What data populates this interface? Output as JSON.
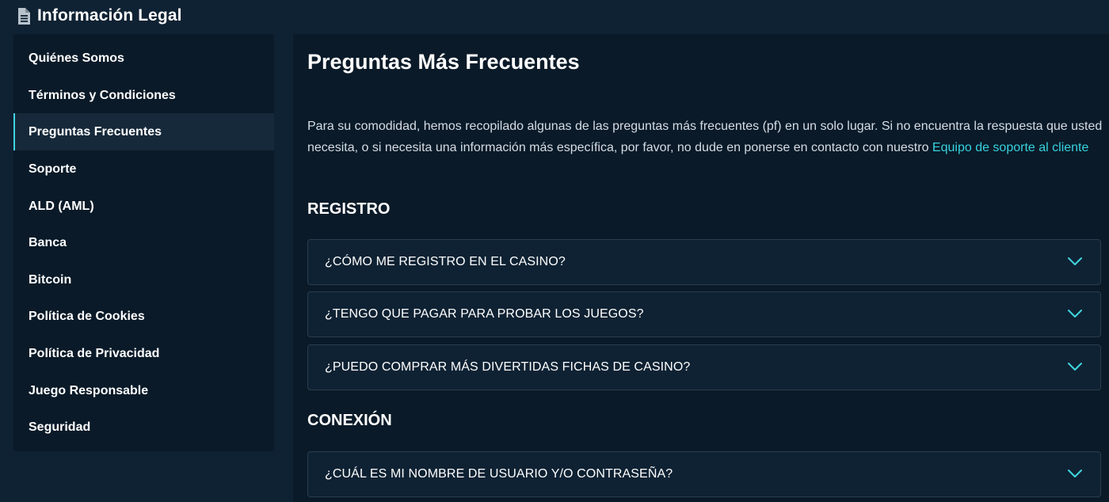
{
  "header": {
    "title": "Información Legal",
    "icon": "document-icon"
  },
  "sidebar": {
    "items": [
      {
        "label": "Quiénes Somos",
        "active": false
      },
      {
        "label": "Términos y Condiciones",
        "active": false
      },
      {
        "label": "Preguntas Frecuentes",
        "active": true
      },
      {
        "label": "Soporte",
        "active": false
      },
      {
        "label": "ALD (AML)",
        "active": false
      },
      {
        "label": "Banca",
        "active": false
      },
      {
        "label": "Bitcoin",
        "active": false
      },
      {
        "label": "Política de Cookies",
        "active": false
      },
      {
        "label": "Política de Privacidad",
        "active": false
      },
      {
        "label": "Juego Responsable",
        "active": false
      },
      {
        "label": "Seguridad",
        "active": false
      }
    ]
  },
  "main": {
    "title": "Preguntas Más Frecuentes",
    "intro_text": "Para su comodidad, hemos recopilado algunas de las preguntas más frecuentes (pf) en un solo lugar. Si no encuentra la respuesta que usted necesita, o si necesita una información más específica, por favor, no dude en ponerse en contacto con nuestro ",
    "intro_link": "Equipo de soporte al cliente",
    "sections": [
      {
        "title": "REGISTRO",
        "questions": [
          "¿CÓMO ME REGISTRO EN EL CASINO?",
          "¿TENGO QUE PAGAR PARA PROBAR LOS JUEGOS?",
          "¿PUEDO COMPRAR MÁS DIVERTIDAS FICHAS DE CASINO?"
        ]
      },
      {
        "title": "CONEXIÓN",
        "questions": [
          "¿CUÁL ES MI NOMBRE DE USUARIO Y/O CONTRASEÑA?"
        ]
      }
    ]
  },
  "colors": {
    "background": "#0f2233",
    "panel": "#0a1a28",
    "accent": "#3fd6e0",
    "link": "#37d2df",
    "text_muted": "#d4dde6"
  }
}
